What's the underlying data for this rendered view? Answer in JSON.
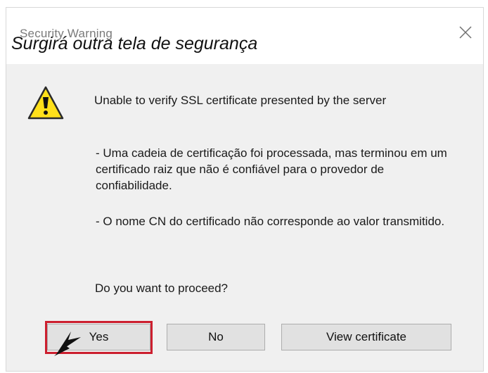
{
  "dialog": {
    "title": "Security Warning",
    "caption": "Surgirá outra tela de segurança",
    "close_icon": "close-icon",
    "warning_icon": "warning-triangle-icon",
    "headline": "Unable to verify SSL certificate presented by the server",
    "detail_1": "- Uma cadeia de certificação foi processada, mas terminou em um certificado raiz que não é confiável para o provedor de confiabilidade.",
    "detail_2": "- O nome CN do certificado não corresponde ao valor transmitido.",
    "prompt": "Do you want to proceed?",
    "buttons": {
      "yes": "Yes",
      "no": "No",
      "view_certificate": "View certificate"
    },
    "highlight_color": "#cc1f2f",
    "pointer_icon": "cursor-arrow-icon"
  }
}
